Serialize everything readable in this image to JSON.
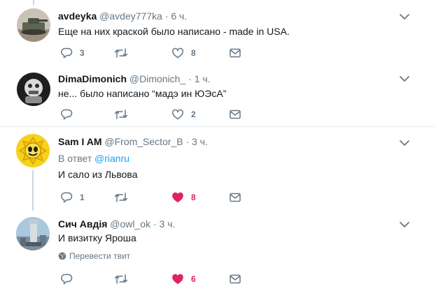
{
  "tweets": [
    {
      "name": "avdeyka",
      "handle": "@avdey777ka",
      "time": "6 ч.",
      "text": "Еще на них краской было написано - made in USA.",
      "replies": "3",
      "retweets": "",
      "likes": "8",
      "liked": false
    },
    {
      "name": "DimaDimonich",
      "handle": "@Dimonich_",
      "time": "1 ч.",
      "text": "не... было написано “мадэ ин ЮЭсА”",
      "replies": "",
      "retweets": "",
      "likes": "2",
      "liked": false
    },
    {
      "name": "Sam I AM",
      "handle": "@From_Sector_B",
      "time": "3 ч.",
      "reply_prefix": "В ответ",
      "reply_mention": "@rianru",
      "text": "И сало из Львова",
      "replies": "1",
      "retweets": "",
      "likes": "8",
      "liked": true
    },
    {
      "name": "Сич Авдія",
      "handle": "@owl_ok",
      "time": "3 ч.",
      "text": "И визитку Яроша",
      "translate": "Перевести твит",
      "replies": "",
      "retweets": "",
      "likes": "6",
      "liked": true
    }
  ],
  "dot": "·",
  "colors": {
    "like_active": "#e0245e",
    "icon_gray": "#657786",
    "link": "#1da1f2",
    "thread_line": "#ccd6dd"
  }
}
